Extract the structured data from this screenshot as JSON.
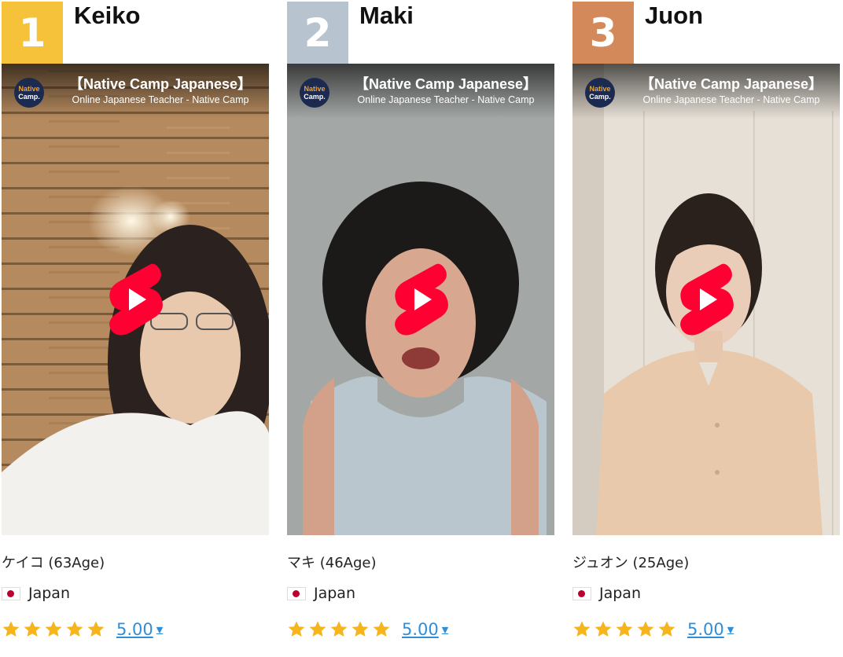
{
  "teachers": [
    {
      "rank": "1",
      "rank_color": "#f6c23a",
      "name": "Keiko",
      "age_text": "ケイコ (63Age)",
      "country": "Japan",
      "rating": "5.00",
      "video": {
        "title": "【Native Camp Japanese】",
        "channel": "Online Japanese Teacher - Native Camp"
      }
    },
    {
      "rank": "2",
      "rank_color": "#b7c3cf",
      "name": "Maki",
      "age_text": "マキ (46Age)",
      "country": "Japan",
      "rating": "5.00",
      "video": {
        "title": "【Native Camp Japanese】",
        "channel": "Online Japanese Teacher - Native Camp"
      }
    },
    {
      "rank": "3",
      "rank_color": "#d3895a",
      "name": "Juon",
      "age_text": "ジュオン (25Age)",
      "country": "Japan",
      "rating": "5.00",
      "video": {
        "title": "【Native Camp Japanese】",
        "channel": "Online Japanese Teacher - Native Camp"
      }
    }
  ],
  "logo": {
    "line1": "Native",
    "line2": "Camp."
  },
  "colors": {
    "star": "#f6b51c",
    "play": "#ff0033",
    "link": "#2f8ed8",
    "flag_red": "#bc002d"
  },
  "icons": {
    "play": "shorts-play-icon",
    "star": "star-icon",
    "caret": "caret-down-icon",
    "flag": "japan-flag-icon"
  }
}
